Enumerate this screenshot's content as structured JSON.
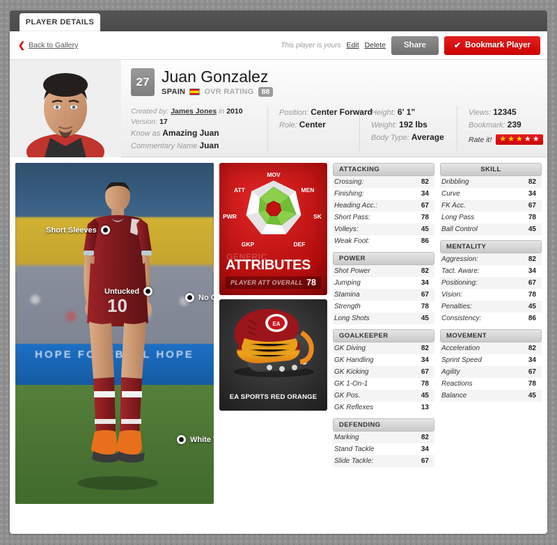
{
  "tab": {
    "label": "PLAYER DETAILS"
  },
  "actionbar": {
    "back_label": "Back to Gallery",
    "back_icon": "chevron-left-icon",
    "ownership_note": "This player is yours",
    "edit_label": "Edit",
    "delete_label": "Delete",
    "share_label": "Share",
    "bookmark_label": "Bookmark Player",
    "bookmark_icon": "check-icon"
  },
  "player": {
    "jersey_number": "27",
    "name": "Juan Gonzalez",
    "country": "SPAIN",
    "country_flag": "spain-flag-icon",
    "ovr_label": "OVR RATING",
    "ovr_value": "88",
    "avatar": "player-face-portrait"
  },
  "meta": {
    "created_by_label": "Created by:",
    "created_by_value": "James Jones",
    "created_in_label": "in",
    "created_year": "2010",
    "version_label": "Version:",
    "version_value": "17",
    "known_as_label": "Know as",
    "known_as_value": "Amazing Juan",
    "commentary_label": "Commentary Name",
    "commentary_value": "Juan",
    "position_label": "Position:",
    "position_value": "Center Forward",
    "role_label": "Role:",
    "role_value": "Center",
    "height_label": "Height:",
    "height_value": "6' 1\"",
    "weight_label": "Weight:",
    "weight_value": "192 lbs",
    "body_type_label": "Body Type:",
    "body_type_value": "Average",
    "views_label": "Views:",
    "views_value": "12345",
    "bookmark_label": "Bookmark:",
    "bookmark_value": "239",
    "rate_label": "Rate it!",
    "rating_filled": 3,
    "rating_total": 5
  },
  "render": {
    "board_text": "HOPE FOOTBALL HOPE",
    "callouts": [
      {
        "id": "co-sleeves",
        "label": "Short Sleeves",
        "side": "left"
      },
      {
        "id": "co-untucked",
        "label": "Untucked",
        "side": "left"
      },
      {
        "id": "co-gloves",
        "label": "No Gloves",
        "side": "right"
      },
      {
        "id": "co-tape",
        "label": "White Tape",
        "side": "right"
      }
    ]
  },
  "attributes_card": {
    "eyebrow": "GENERIC",
    "title": "ATTRIBUTES",
    "overall_label": "PLAYER ATT OVERALL",
    "overall_value": "78"
  },
  "boot_card": {
    "name": "EA SPORTS RED ORANGE"
  },
  "chart_data": {
    "type": "radar",
    "title": "ATTRIBUTES",
    "categories": [
      "MOV",
      "MEN",
      "SK",
      "DEF",
      "GKP",
      "PWR",
      "ATT"
    ],
    "values": [
      78,
      70,
      82,
      64,
      58,
      54,
      62
    ],
    "rmax": 100,
    "grid": false,
    "legend": "none",
    "fill_color": "#7ac943",
    "outer_color": "#f2f2f2",
    "bg_color": "#c21111"
  },
  "panels": {
    "col1": [
      {
        "title": "ATTACKING",
        "center": false,
        "rows": [
          {
            "label": "Crossing:",
            "value": "82"
          },
          {
            "label": "Finishing:",
            "value": "34"
          },
          {
            "label": "Heading Acc.:",
            "value": "67"
          },
          {
            "label": "Short Pass:",
            "value": "78"
          },
          {
            "label": "Volleys:",
            "value": "45"
          },
          {
            "label": "Weak Foot:",
            "value": "86"
          }
        ]
      },
      {
        "title": "POWER",
        "center": false,
        "rows": [
          {
            "label": "Shot Power",
            "value": "82"
          },
          {
            "label": "Jumping",
            "value": "34"
          },
          {
            "label": "Stamina",
            "value": "67"
          },
          {
            "label": "Strength",
            "value": "78"
          },
          {
            "label": "Long Shots",
            "value": "45"
          }
        ]
      },
      {
        "title": "GOALKEEPER",
        "center": false,
        "rows": [
          {
            "label": "GK Diving",
            "value": "82"
          },
          {
            "label": "GK Handling",
            "value": "34"
          },
          {
            "label": "GK Kicking",
            "value": "67"
          },
          {
            "label": "GK 1-On-1",
            "value": "78"
          },
          {
            "label": "GK Pos.",
            "value": "45"
          },
          {
            "label": "GK Reflexes",
            "value": "13"
          }
        ]
      },
      {
        "title": "DEFENDING",
        "center": false,
        "rows": [
          {
            "label": "Marking",
            "value": "82"
          },
          {
            "label": "Stand Tackle",
            "value": "34"
          },
          {
            "label": "Slide Tackle:",
            "value": "67"
          }
        ]
      }
    ],
    "col2": [
      {
        "title": "SKILL",
        "center": true,
        "rows": [
          {
            "label": "Dribbling",
            "value": "82"
          },
          {
            "label": "Curve",
            "value": "34"
          },
          {
            "label": "FK Acc.",
            "value": "67"
          },
          {
            "label": "Long Pass",
            "value": "78"
          },
          {
            "label": "Ball Control",
            "value": "45"
          }
        ]
      },
      {
        "title": "MENTALITY",
        "center": false,
        "rows": [
          {
            "label": "Aggression:",
            "value": "82"
          },
          {
            "label": "Tact. Aware:",
            "value": "34"
          },
          {
            "label": "Positioning:",
            "value": "67"
          },
          {
            "label": "Vision:",
            "value": "78"
          },
          {
            "label": "Penalties:",
            "value": "45"
          },
          {
            "label": "Consistency:",
            "value": "86"
          }
        ]
      },
      {
        "title": "MOVEMENT",
        "center": false,
        "rows": [
          {
            "label": "Acceleration",
            "value": "82"
          },
          {
            "label": "Sprint Speed",
            "value": "34"
          },
          {
            "label": "Agility",
            "value": "67"
          },
          {
            "label": "Reactions",
            "value": "78"
          },
          {
            "label": "Balance",
            "value": "45"
          }
        ]
      }
    ]
  }
}
